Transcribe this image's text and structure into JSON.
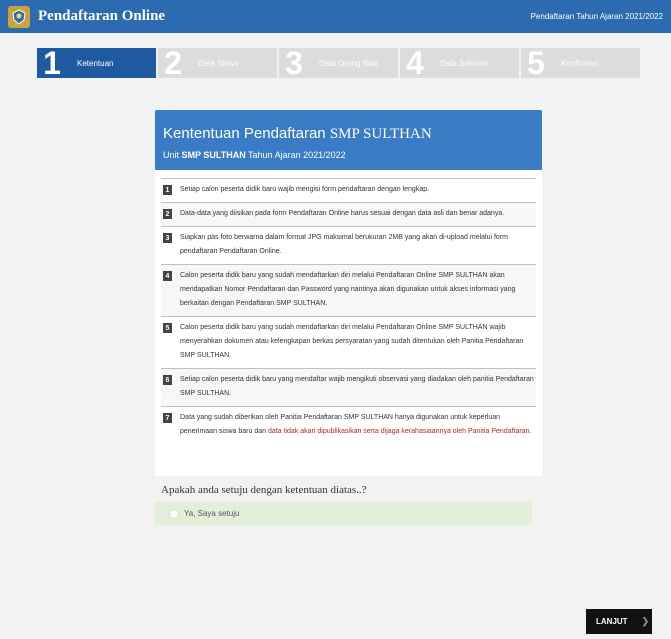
{
  "header": {
    "title": "Pendaftaran Online",
    "year_label": "Pendaftaran Tahun Ajaran 2021/2022",
    "logo_icon": "school-crest-icon"
  },
  "steps": [
    {
      "number": "1",
      "label": "Ketentuan",
      "active": true
    },
    {
      "number": "2",
      "label": "Data Siswa",
      "active": false
    },
    {
      "number": "3",
      "label": "Data Orang Wali",
      "active": false
    },
    {
      "number": "4",
      "label": "Data Sekolah",
      "active": false
    },
    {
      "number": "5",
      "label": "Konfirmasi",
      "active": false
    }
  ],
  "card": {
    "title_prefix": "Kententuan Pendaftaran",
    "title_school": "SMP SULTHAN",
    "sub_prefix": "Unit",
    "sub_school": "SMP SULTHAN",
    "sub_suffix": "Tahun Ajaran 2021/2022"
  },
  "rules": [
    {
      "n": "1",
      "text": "Setiap calon peserta didik baru wajib mengisi form pendaftaran dengan lengkap."
    },
    {
      "n": "2",
      "text": "Data-data yang diisikan pada form Pendaftaran Online harus sesuai dengan data asli dan benar adanya."
    },
    {
      "n": "3",
      "text": "Siapkan pas foto berwarna dalam format JPG maksimal berukuran 2MB yang akan di-upload melalui form pendaftaran Pendaftaran Online."
    },
    {
      "n": "4",
      "text": "Calon peserta didik baru yang sudah mendaftarkan diri melalui Pendaftaran Online SMP SULTHAN akan mendapatkan Nomor Pendaftaran dan Password yang nantinya akan digunakan untuk akses informasi yang berkaitan dengan Pendaftaran SMP SULTHAN."
    },
    {
      "n": "5",
      "text": "Calon peserta didik baru yang sudah mendaftarkan diri melalui Pendaftaran Online SMP SULTHAN wajib menyerahkan dokumen atau kelengkapan berkas persyaratan yang sudah ditentukan oleh Panitia Pendaftaran SMP SULTHAN."
    },
    {
      "n": "6",
      "text": "Setiap calon peserta didik baru yang mendaftar wajib mengikuti observasi yang diadakan oleh panitia Pendaftaran SMP SULTHAN."
    },
    {
      "n": "7",
      "text": "Data yang sudah diberikan oleh Panitia Pendaftaran SMP SULTHAN hanya digunakan untuk keperluan penerimaan siswa baru dan",
      "warn": "data tidak akan dipublikasikan serta dijaga kerahasiaannya oleh Panitia Pendaftaran."
    }
  ],
  "question": "Apakah anda setuju dengan ketentuan diatas..?",
  "agree_label": "Ya, Saya setuju",
  "next_label": "LANJUT",
  "next_icon": "chevron-right-icon",
  "colors": {
    "header": "#2c6bb0",
    "step_active": "#1f5aa0",
    "card_header": "#3a7bc5",
    "agree_bg": "#e3f0d9"
  }
}
